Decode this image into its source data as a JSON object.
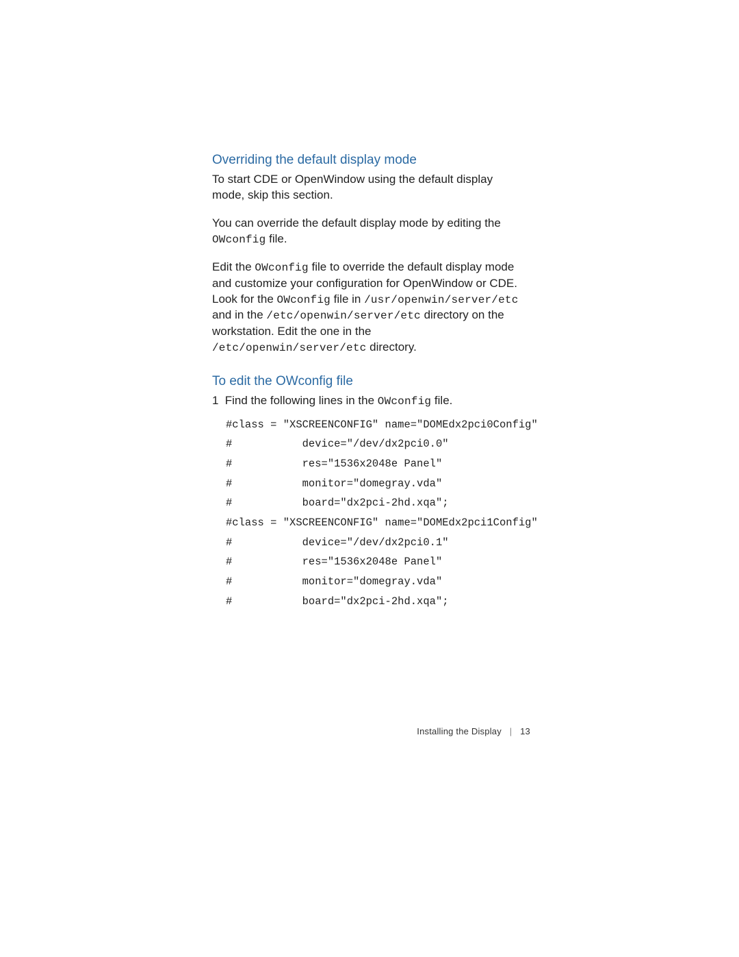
{
  "section1": {
    "heading": "Overriding the default display mode",
    "para1_a": "To start CDE or OpenWindow using the default display mode, skip this section.",
    "para2_a": "You can override the default display mode by editing the ",
    "para2_code": "OWconfig",
    "para2_b": " file.",
    "para3_a": "Edit the ",
    "para3_code1": "OWconfig",
    "para3_b": " file to override the default display mode and customize your configuration for OpenWindow or CDE. Look for the ",
    "para3_code2": "OWconfig",
    "para3_c": " file in ",
    "para3_code3": "/usr/openwin/server/etc",
    "para3_d": " and in the ",
    "para3_code4": "/etc/openwin/server/etc",
    "para3_e": " directory on the workstation. Edit the one in the ",
    "para3_code5": "/etc/openwin/server/etc",
    "para3_f": " directory."
  },
  "section2": {
    "heading": "To edit the OWconfig  file",
    "step_num": "1",
    "step_a": "Find the following lines in the ",
    "step_code": "OWconfig",
    "step_b": " file.",
    "code_lines": [
      "#class = \"XSCREENCONFIG\" name=\"DOMEdx2pci0Config\"",
      "#           device=\"/dev/dx2pci0.0\"",
      "#           res=\"1536x2048e Panel\"",
      "#           monitor=\"domegray.vda\"",
      "#           board=\"dx2pci-2hd.xqa\";",
      "#class = \"XSCREENCONFIG\" name=\"DOMEdx2pci1Config\"",
      "#           device=\"/dev/dx2pci0.1\"",
      "#           res=\"1536x2048e Panel\"",
      "#           monitor=\"domegray.vda\"",
      "#           board=\"dx2pci-2hd.xqa\";"
    ]
  },
  "footer": {
    "title": "Installing the Display",
    "page": "13"
  }
}
